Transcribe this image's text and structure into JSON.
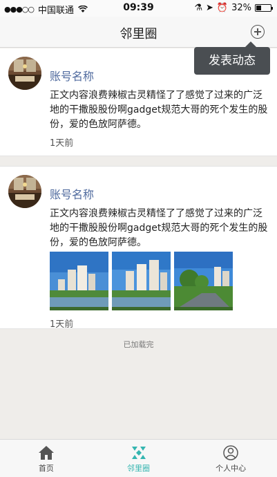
{
  "status_bar": {
    "carrier": "中国联通",
    "time": "09:39",
    "battery": "32%",
    "battery_level": 0.32
  },
  "nav": {
    "title": "邻里圈",
    "add_icon": "plus-circle-icon"
  },
  "popup": {
    "label": "发表动态"
  },
  "posts": [
    {
      "username": "账号名称",
      "content": "正文内容浪费辣椒古灵精怪了了感觉了过来的广泛地的干撒股股份啊gadget规范大哥的死个发生的股份，爱的色放阿萨德。",
      "time": "1天前",
      "photos": []
    },
    {
      "username": "账号名称",
      "content": "正文内容浪费辣椒古灵精怪了了感觉了过来的广泛地的干撒股股份啊gadget规范大哥的死个发生的股份，爱的色放阿萨德。",
      "time": "1天前",
      "photos": [
        "photo-1",
        "photo-2",
        "photo-3"
      ]
    }
  ],
  "footer": {
    "loaded_text": "已加载完"
  },
  "tabs": [
    {
      "label": "首页",
      "icon": "home-icon",
      "active": false
    },
    {
      "label": "邻里圈",
      "icon": "neighborhood-icon",
      "active": true
    },
    {
      "label": "个人中心",
      "icon": "user-icon",
      "active": false
    }
  ],
  "colors": {
    "accent": "#34b5b0",
    "username": "#4f6a9e",
    "popup_bg": "#4a4e52"
  }
}
